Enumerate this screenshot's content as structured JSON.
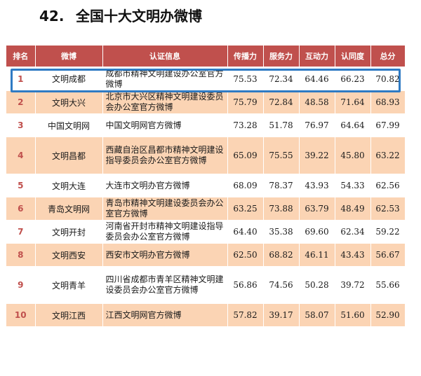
{
  "title": {
    "number": "42.",
    "text": "全国十大文明办微博"
  },
  "table": {
    "headers": [
      "排名",
      "微博",
      "认证信息",
      "传播力",
      "服务力",
      "互动力",
      "认同度",
      "总分"
    ],
    "rows": [
      {
        "rank": "1",
        "name": "文明成都",
        "cert": "成都市精神文明建设办公室官方微博",
        "spread": "75.53",
        "service": "72.34",
        "interact": "64.46",
        "approval": "66.23",
        "total": "70.82"
      },
      {
        "rank": "2",
        "name": "文明大兴",
        "cert": "北京市大兴区精神文明建设委员会办公室官方微博",
        "spread": "75.79",
        "service": "72.84",
        "interact": "48.58",
        "approval": "71.64",
        "total": "68.93"
      },
      {
        "rank": "3",
        "name": "中国文明网",
        "cert": "中国文明网官方微博",
        "spread": "73.28",
        "service": "51.78",
        "interact": "76.97",
        "approval": "64.64",
        "total": "67.99"
      },
      {
        "rank": "4",
        "name": "文明昌都",
        "cert": "西藏自治区昌都市精神文明建设指导委员会办公室官方微博",
        "spread": "65.09",
        "service": "75.55",
        "interact": "39.22",
        "approval": "45.80",
        "total": "63.22"
      },
      {
        "rank": "5",
        "name": "文明大连",
        "cert": "大连市文明办官方微博",
        "spread": "68.09",
        "service": "78.37",
        "interact": "43.93",
        "approval": "54.33",
        "total": "62.56"
      },
      {
        "rank": "6",
        "name": "青岛文明网",
        "cert": "青岛市精神文明建设委员会办公室官方微博",
        "spread": "63.25",
        "service": "73.88",
        "interact": "63.79",
        "approval": "48.49",
        "total": "62.53"
      },
      {
        "rank": "7",
        "name": "文明开封",
        "cert": "河南省开封市精神文明建设指导委员会办公室官方微博",
        "spread": "64.40",
        "service": "35.38",
        "interact": "69.60",
        "approval": "62.34",
        "total": "59.22"
      },
      {
        "rank": "8",
        "name": "文明西安",
        "cert": "西安市文明办官方微博",
        "spread": "62.50",
        "service": "68.82",
        "interact": "46.11",
        "approval": "43.43",
        "total": "56.67"
      },
      {
        "rank": "9",
        "name": "文明青羊",
        "cert": "四川省成都市青羊区精神文明建设委员会办公室官方微博",
        "spread": "56.86",
        "service": "74.56",
        "interact": "50.28",
        "approval": "39.72",
        "total": "55.66"
      },
      {
        "rank": "10",
        "name": "文明江西",
        "cert": "江西文明网官方微博",
        "spread": "57.82",
        "service": "39.17",
        "interact": "58.07",
        "approval": "51.60",
        "total": "52.90"
      }
    ]
  },
  "colors": {
    "header_bg": "#c0504d",
    "row_alt_bg": "#fbd4b4",
    "rank_text": "#c0504d",
    "highlight_border": "#2f7bc4"
  },
  "highlighted_row": 0
}
